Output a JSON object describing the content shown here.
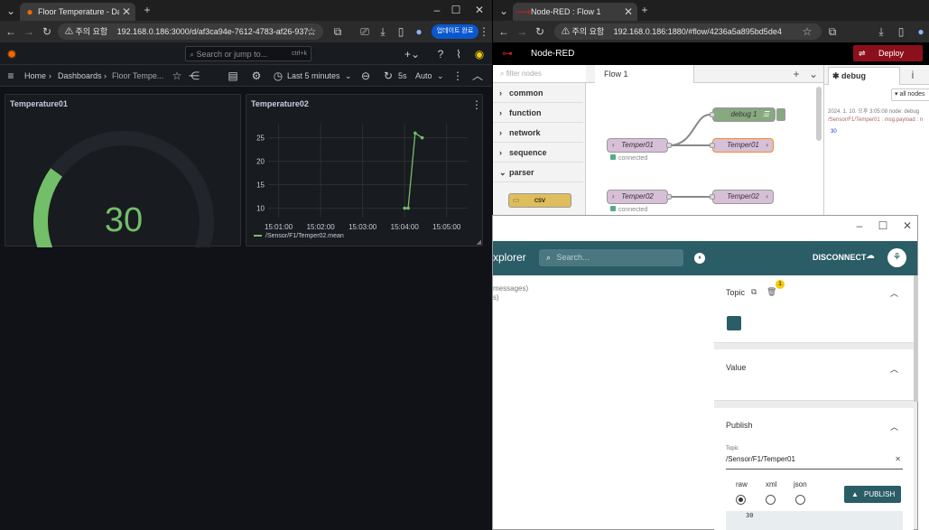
{
  "left_browser": {
    "tab_title": "Floor Temperature - Dashboard",
    "security_label": "주의 요함",
    "url": "192.168.0.186:3000/d/af3ca94e-7612-4783-af26-937...",
    "update_button": "업데이트 완료"
  },
  "grafana": {
    "search_placeholder": "Search or jump to...",
    "search_shortcut": "ctrl+k",
    "breadcrumb": {
      "home": "Home",
      "dashboards": "Dashboards",
      "current": "Floor Tempe..."
    },
    "time_range": "Last 5 minutes",
    "refresh_interval": "5s",
    "refresh_mode": "Auto",
    "panel1": {
      "title": "Temperature01",
      "value": "30",
      "value_number": 30,
      "gauge_fraction": 0.3
    },
    "panel2": {
      "title": "Temperature02",
      "legend": "/Sensor/F1/Temper02.mean"
    }
  },
  "chart_data": {
    "type": "line",
    "title": "Temperature02",
    "x": [
      "15:04:00",
      "15:04:05",
      "15:04:15",
      "15:04:25"
    ],
    "x_ticks": [
      "15:01:00",
      "15:02:00",
      "15:03:00",
      "15:04:00",
      "15:05:00"
    ],
    "series": [
      {
        "name": "/Sensor/F1/Temper02.mean",
        "values": [
          10,
          10,
          26,
          25
        ]
      }
    ],
    "y_ticks": [
      "25",
      "20",
      "15",
      "10"
    ],
    "ylim": [
      8,
      28
    ],
    "grid": true,
    "legend": "bottom-left",
    "color": "#73bf69"
  },
  "right_browser": {
    "tab_title": "Node-RED : Flow 1",
    "security_label": "주의 요함",
    "url": "192.168.0.186:1880/#flow/4236a5a895bd5de4"
  },
  "nodered": {
    "brand": "Node-RED",
    "deploy": "Deploy",
    "filter_placeholder": "filter nodes",
    "palette": [
      "common",
      "function",
      "network",
      "sequence",
      "parser"
    ],
    "palette_node": "csv",
    "flow_tab": "Flow 1",
    "nodes": {
      "debug": "debug 1",
      "in1": "Temper01",
      "out1": "Temper01",
      "in2": "Temper02",
      "out2": "Temper02"
    },
    "status": "connected",
    "sidebar_tab": "debug",
    "all_nodes": "all nodes",
    "debug_meta": "2024. 1. 10. 오후 3:05:08  node: debug",
    "debug_topic": "/Sensor/F1/Temper01 : msg.payload : n",
    "debug_value": "30"
  },
  "mqtt": {
    "title": "xplorer",
    "search_placeholder": "Search...",
    "disconnect": "DISCONNECT",
    "messages_text": "messages)",
    "messages_text2": "s)",
    "topic_label": "Topic",
    "topic_badge": "1",
    "value_label": "Value",
    "publish_label": "Publish",
    "topic_field_label": "Topic",
    "topic_field_value": "/Sensor/F1/Temper01",
    "formats": [
      "raw",
      "xml",
      "json"
    ],
    "selected_format": "raw",
    "publish_button": "PUBLISH",
    "payload": "30"
  }
}
